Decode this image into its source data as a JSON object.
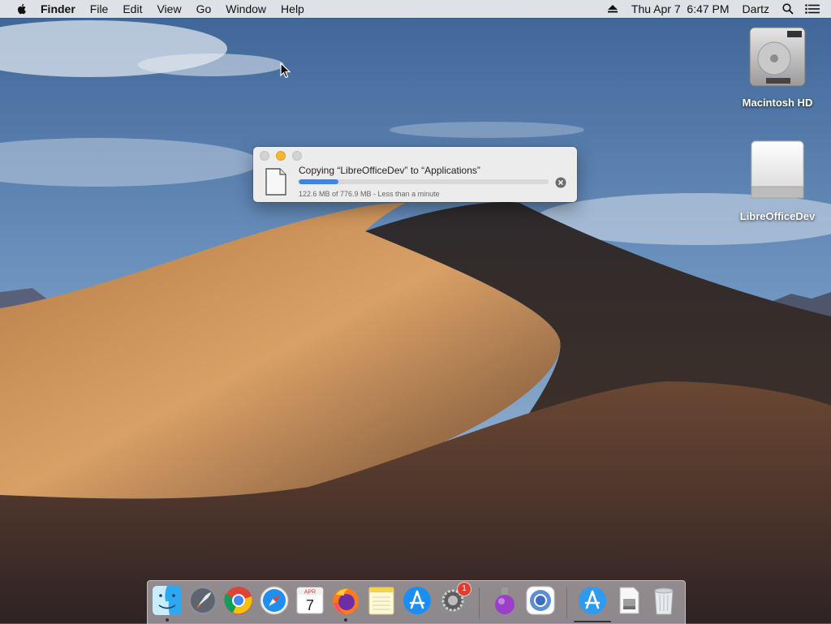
{
  "menubar": {
    "app_name": "Finder",
    "menus": [
      "File",
      "Edit",
      "View",
      "Go",
      "Window",
      "Help"
    ],
    "datetime": "Thu Apr 7  6:47 PM",
    "user": "Dartz"
  },
  "desktop": {
    "icons": [
      {
        "label": "Macintosh HD",
        "icon": "hard-drive-icon"
      },
      {
        "label": "LibreOfficeDev",
        "icon": "mounted-disk-icon"
      }
    ]
  },
  "copy_dialog": {
    "title": "Copying “LibreOfficeDev” to “Applications”",
    "progress_fraction": 0.158,
    "status": "122.6 MB of 776.9 MB - Less than a minute"
  },
  "dock": {
    "items": [
      {
        "name": "Finder",
        "icon": "finder-icon",
        "running": true
      },
      {
        "name": "Launchpad",
        "icon": "launchpad-icon",
        "running": false
      },
      {
        "name": "Google Chrome",
        "icon": "chrome-icon",
        "running": false
      },
      {
        "name": "Safari",
        "icon": "safari-icon",
        "running": false
      },
      {
        "name": "Calendar",
        "icon": "calendar-icon",
        "running": false,
        "month": "APR",
        "day": "7"
      },
      {
        "name": "Firefox",
        "icon": "firefox-icon",
        "running": true
      },
      {
        "name": "Notes",
        "icon": "notes-icon",
        "running": false
      },
      {
        "name": "App Store",
        "icon": "app-store-icon",
        "running": false
      },
      {
        "name": "System Preferences",
        "icon": "system-preferences-icon",
        "running": false,
        "badge": "1"
      },
      {
        "name": "Utility",
        "icon": "purple-flask-icon",
        "running": false
      },
      {
        "name": "Chromium",
        "icon": "chromium-icon",
        "running": false
      },
      {
        "name": "Applications",
        "icon": "applications-folder-icon",
        "running": false
      },
      {
        "name": "Installer Disk",
        "icon": "disk-image-icon",
        "running": false
      },
      {
        "name": "Trash",
        "icon": "trash-icon",
        "running": false
      }
    ]
  },
  "colors": {
    "accent": "#3b82f6",
    "minimize": "#f5b632",
    "badge": "#e53b2e"
  }
}
